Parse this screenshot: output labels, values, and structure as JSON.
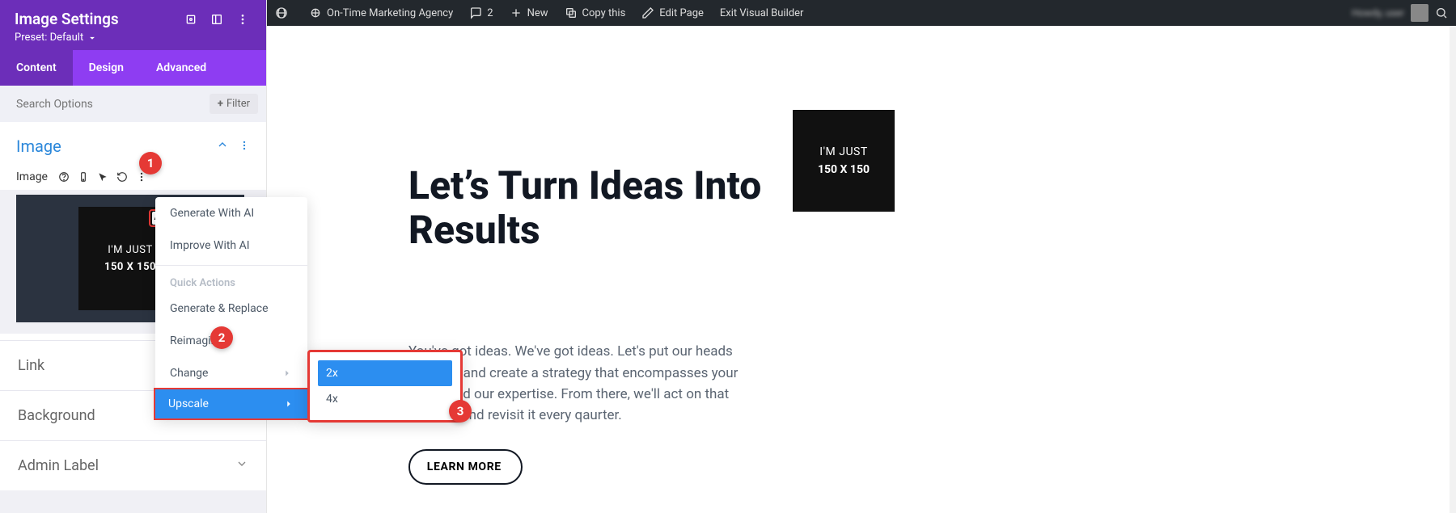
{
  "wp_bar": {
    "site": "On-Time Marketing Agency",
    "comments": "2",
    "new_label": "New",
    "copy": "Copy this",
    "edit": "Edit Page",
    "exit": "Exit Visual Builder"
  },
  "panel": {
    "title": "Image Settings",
    "preset_label": "Preset: Default",
    "tabs": {
      "content": "Content",
      "design": "Design",
      "advanced": "Advanced"
    },
    "search_placeholder": "Search Options",
    "filter_label": "Filter",
    "section": "Image",
    "field_label": "Image",
    "thumb_line1": "I'M JUST",
    "thumb_line2": "150 X 150",
    "ai_icon": "AI",
    "accordions": {
      "link": "Link",
      "background": "Background",
      "admin_label": "Admin Label"
    }
  },
  "menu": {
    "generate": "Generate With AI",
    "improve": "Improve With AI",
    "quick": "Quick Actions",
    "generate_replace": "Generate & Replace",
    "reimagine": "Reimagine",
    "change": "Change",
    "upscale": "Upscale"
  },
  "submenu": {
    "x2": "2x",
    "x4": "4x"
  },
  "badges": {
    "b1": "1",
    "b2": "2",
    "b3": "3"
  },
  "preview": {
    "heading": "Let’s Turn Ideas Into Results",
    "paragraph": "You've got ideas. We've got ideas. Let's put our heads together and create a strategy that encompasses your vision and our expertise. From there, we'll act on that strategy and revisit it every qaurter.",
    "button": "LEARN MORE",
    "thumb_line1": "I'M JUST",
    "thumb_line2": "150 X 150"
  }
}
